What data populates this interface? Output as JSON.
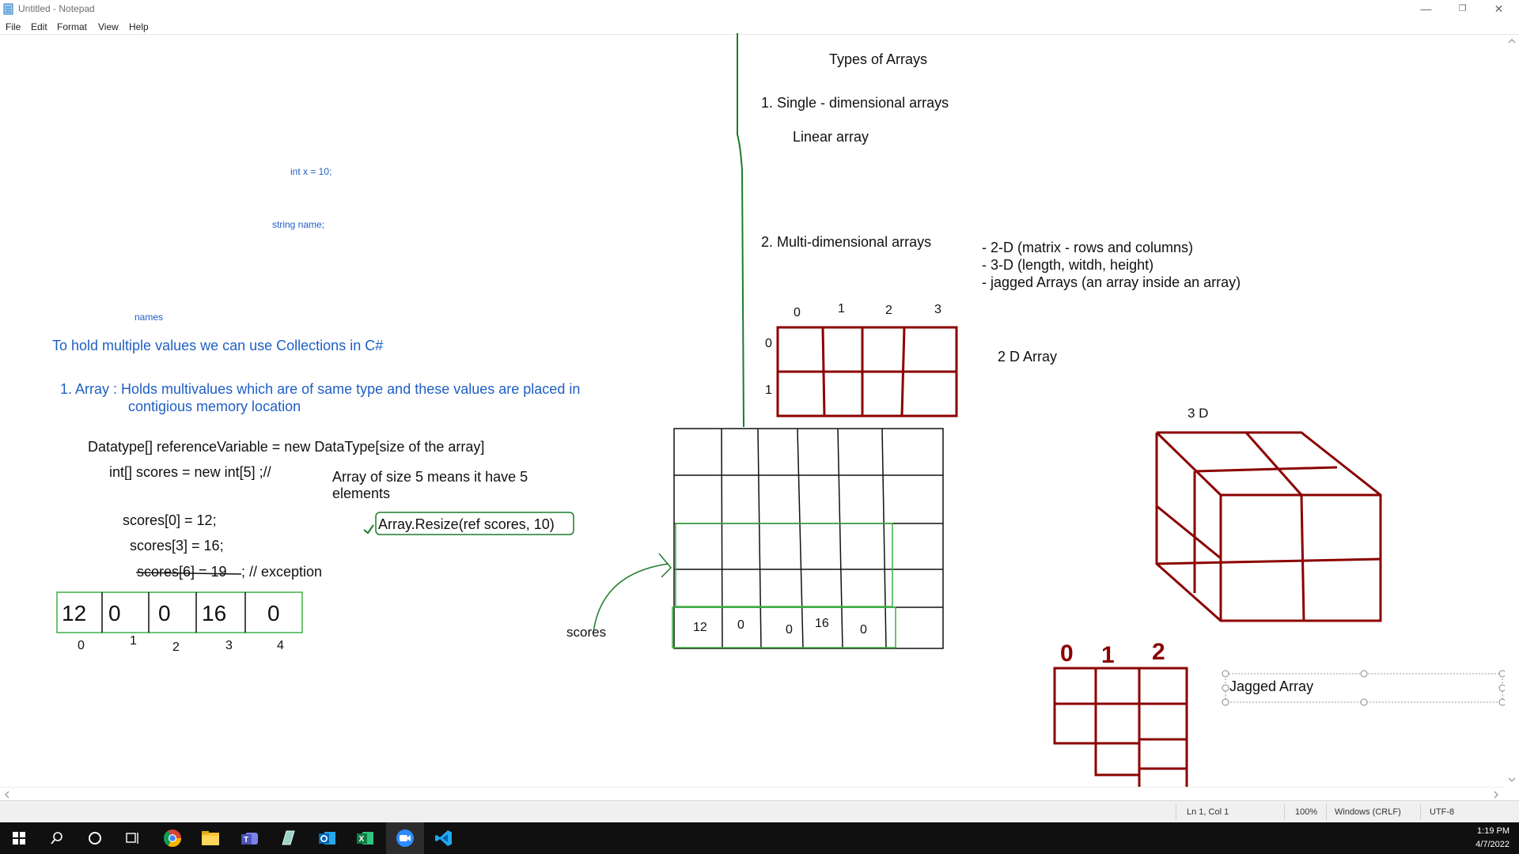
{
  "window": {
    "title": "Untitled - Notepad",
    "controls": {
      "minimize": "—",
      "restore": "❐",
      "close": "✕"
    }
  },
  "menu": [
    "File",
    "Edit",
    "Format",
    "View",
    "Help"
  ],
  "notes": {
    "int_x": "int x = 10;",
    "string_name": "string name;",
    "names": "names",
    "collections": "To hold multiple values we can use Collections in C#",
    "array_def_1": "1. Array  : Holds multivalues which are of same type and these values are placed in",
    "array_def_2": "contigious memory location",
    "datatype": "Datatype[] referenceVariable = new DataType[size of the array]",
    "int_scores": "int[] scores = new int[5]  ;//",
    "size_comment_1": "Array of size 5 means it have 5",
    "size_comment_2": "elements",
    "resize": "Array.Resize(ref scores, 10)",
    "scores0": "scores[0] = 12;",
    "scores3": "scores[3] = 16;",
    "scores6": "scores[6] = 19",
    "exception": "; // exception",
    "scores_label": "scores",
    "types_title": "Types of Arrays",
    "single": "1. Single - dimensional arrays",
    "linear": "Linear array",
    "multi": "2. Multi-dimensional arrays",
    "multi_2d": "- 2-D (matrix - rows and columns)",
    "multi_3d": "- 3-D (length, witdh, height)",
    "multi_jag": "- jagged Arrays (an array inside an array)",
    "label_2d": "2 D Array",
    "label_3d": "3 D",
    "jagged": "Jagged Array"
  },
  "array_cells": [
    "12",
    "0",
    "0",
    "16",
    "0"
  ],
  "array_indexes": [
    "0",
    "1",
    "2",
    "3",
    "4"
  ],
  "big_row_values": [
    "12",
    "0",
    "0",
    "16",
    "0"
  ],
  "matrix_col_idx": [
    "0",
    "1",
    "2",
    "3"
  ],
  "matrix_row_idx": [
    "0",
    "1"
  ],
  "jagged_idx": [
    "0",
    "1",
    "2"
  ],
  "status": {
    "position": "Ln 1, Col 1",
    "zoom": "100%",
    "line_ending": "Windows (CRLF)",
    "encoding": "UTF-8"
  },
  "clock": {
    "time": "1:19 PM",
    "date": "4/7/2022"
  },
  "taskbar_icons": [
    "windows-start-icon",
    "search-icon",
    "cortana-icon",
    "task-view-icon",
    "chrome-icon",
    "file-explorer-icon",
    "teams-icon",
    "notes-app-icon",
    "outlook-icon",
    "excel-icon",
    "zoom-icon",
    "vscode-icon"
  ],
  "colors": {
    "ink_blue": "#1f5fc4",
    "ink_green": "#1e7b2a",
    "ink_red": "#8b0000",
    "highlight_green": "#3cb043"
  }
}
